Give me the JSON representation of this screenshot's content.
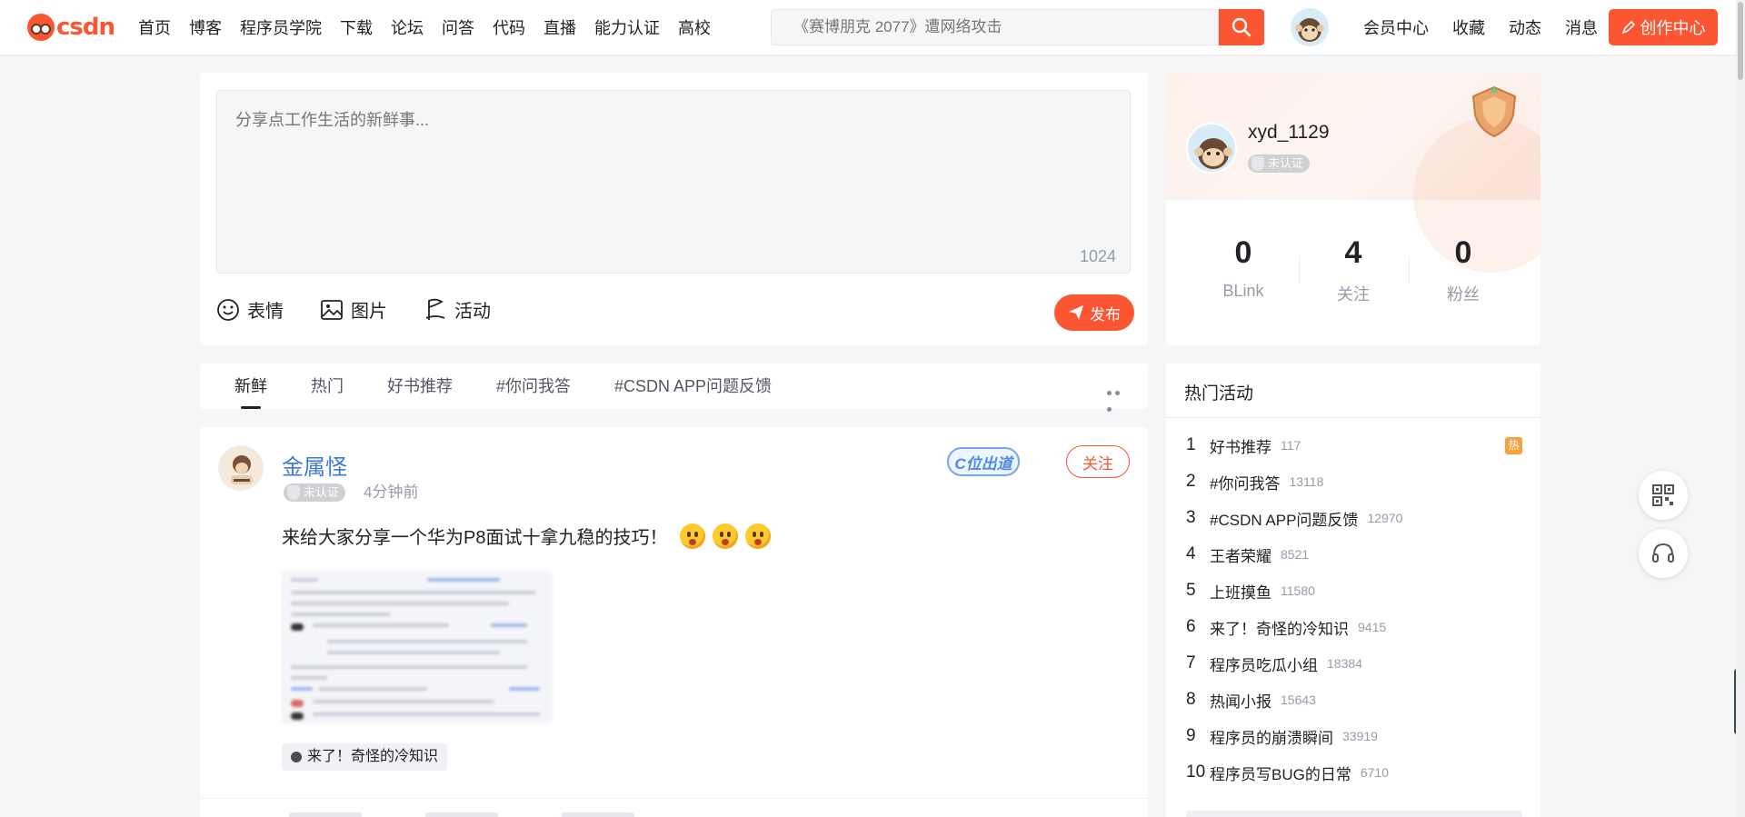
{
  "header": {
    "logo_text": "CSDN",
    "nav": [
      "首页",
      "博客",
      "程序员学院",
      "下载",
      "论坛",
      "问答",
      "代码",
      "直播",
      "能力认证",
      "高校"
    ],
    "search_placeholder": "《赛博朋克 2077》遭网络攻击",
    "links": [
      "会员中心",
      "收藏",
      "动态",
      "消息"
    ],
    "create_button": "创作中心"
  },
  "composer": {
    "placeholder": "分享点工作生活的新鲜事...",
    "char_count": "1024",
    "tools": [
      "表情",
      "图片",
      "活动"
    ],
    "publish_label": "发布"
  },
  "tabs": [
    "新鲜",
    "热门",
    "好书推荐",
    "#你问我答",
    "#CSDN APP问题反馈"
  ],
  "post": {
    "author": "金属怪",
    "cert": "未认证",
    "time": "4分钟前",
    "stamp": "C位出道",
    "follow_label": "关注",
    "text": "来给大家分享一个华为P8面试十拿九稳的技巧！",
    "topic": "来了！奇怪的冷知识"
  },
  "profile": {
    "username": "xyd_1129",
    "cert": "未认证",
    "stats": [
      {
        "num": "0",
        "label": "BLink"
      },
      {
        "num": "4",
        "label": "关注"
      },
      {
        "num": "0",
        "label": "粉丝"
      }
    ]
  },
  "hot_topics": {
    "title": "热门活动",
    "hot_badge": "热",
    "items": [
      {
        "rank": "1",
        "name": "好书推荐",
        "count": "117"
      },
      {
        "rank": "2",
        "name": "#你问我答",
        "count": "13118"
      },
      {
        "rank": "3",
        "name": "#CSDN APP问题反馈",
        "count": "12970"
      },
      {
        "rank": "4",
        "name": "王者荣耀",
        "count": "8521"
      },
      {
        "rank": "5",
        "name": "上班摸鱼",
        "count": "11580"
      },
      {
        "rank": "6",
        "name": "来了！奇怪的冷知识",
        "count": "9415"
      },
      {
        "rank": "7",
        "name": "程序员吃瓜小组",
        "count": "18384"
      },
      {
        "rank": "8",
        "name": "热闻小报",
        "count": "15643"
      },
      {
        "rank": "9",
        "name": "程序员的崩溃瞬间",
        "count": "33919"
      },
      {
        "rank": "10",
        "name": "程序员写BUG的日常",
        "count": "6710"
      }
    ]
  },
  "colors": {
    "accent": "#fc5531",
    "link": "#3b7ad9",
    "muted": "#999aaa"
  }
}
